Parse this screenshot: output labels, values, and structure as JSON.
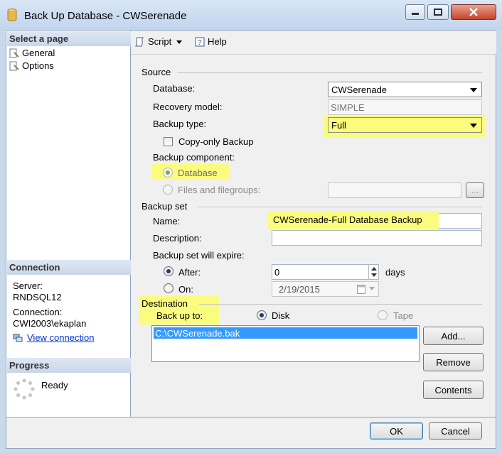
{
  "window": {
    "title": "Back Up Database - CWSerenade"
  },
  "left": {
    "select_page_header": "Select a page",
    "pages": [
      "General",
      "Options"
    ],
    "connection_header": "Connection",
    "server_label": "Server:",
    "server_value": "RNDSQL12",
    "connection_label": "Connection:",
    "connection_value": "CWI2003\\ekaplan",
    "view_connection": "View connection",
    "progress_header": "Progress",
    "progress_status": "Ready"
  },
  "toolbar": {
    "script_label": "Script",
    "help_label": "Help"
  },
  "source": {
    "group_label": "Source",
    "database_label": "Database:",
    "database_value": "CWSerenade",
    "recovery_label": "Recovery model:",
    "recovery_value": "SIMPLE",
    "backup_type_label": "Backup type:",
    "backup_type_value": "Full",
    "copy_only_label": "Copy-only Backup",
    "component_label": "Backup component:",
    "component_database": "Database",
    "component_files": "Files and filegroups:"
  },
  "backup_set": {
    "group_label": "Backup set",
    "name_label": "Name:",
    "name_value": "CWSerenade-Full Database Backup",
    "description_label": "Description:",
    "description_value": "",
    "expire_label": "Backup set will expire:",
    "after_label": "After:",
    "after_value": "0",
    "days_label": "days",
    "on_label": "On:",
    "on_value": "2/19/2015"
  },
  "destination": {
    "group_label": "Destination",
    "backup_to_label": "Back up to:",
    "disk_label": "Disk",
    "tape_label": "Tape",
    "files": [
      "C:\\CWSerenade.bak"
    ],
    "add_label": "Add...",
    "remove_label": "Remove",
    "contents_label": "Contents",
    "browse_label": "..."
  },
  "footer": {
    "ok_label": "OK",
    "cancel_label": "Cancel"
  },
  "colors": {
    "highlight": "#fbfc7e",
    "selection": "#3399ff",
    "link": "#0033cc"
  }
}
